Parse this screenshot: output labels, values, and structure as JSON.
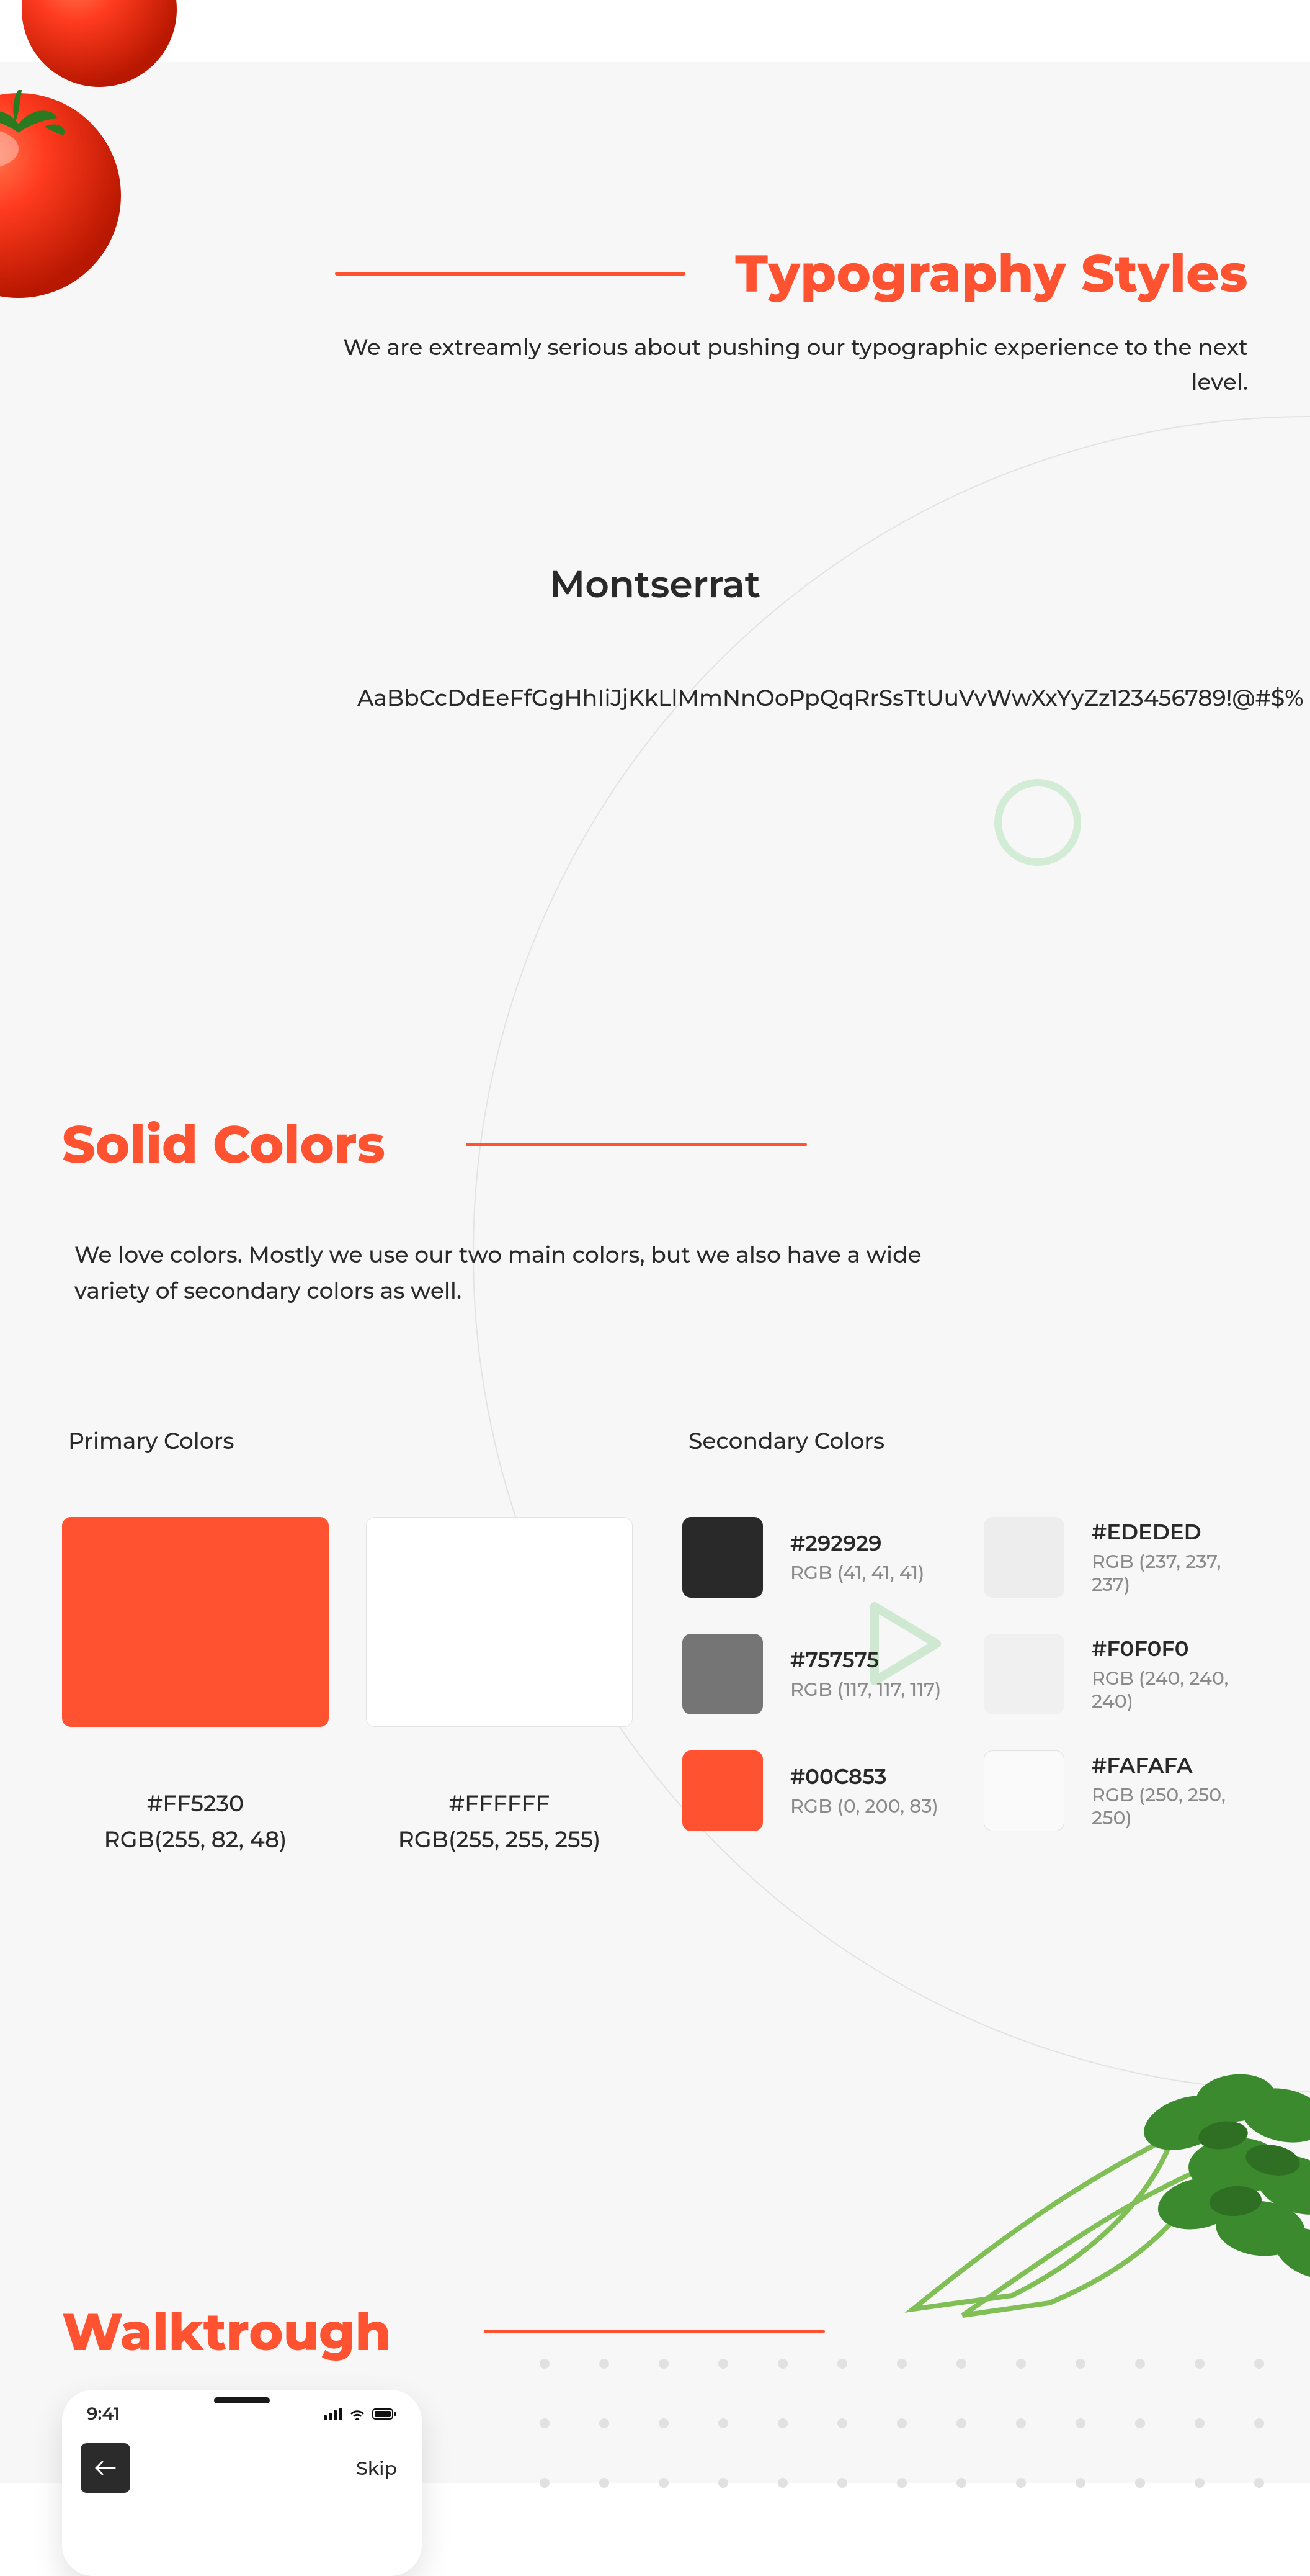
{
  "typography": {
    "title": "Typography Styles",
    "subtitle": "We are extreamly serious about pushing our typographic experience to the next level.",
    "font_name": "Montserrat",
    "glyphs": "AaBbCcDdEeFfGgHhIiJjKkLlMmNnOoPpQqRrSsTtUuVvWwXxYyZz123456789!@#$%"
  },
  "colors": {
    "title": "Solid Colors",
    "subtitle": "We love colors. Mostly we use our two main colors, but we also have a wide variety of secondary colors as well.",
    "primary_label": "Primary Colors",
    "secondary_label": "Secondary Colors",
    "primary": [
      {
        "hex": "#FF5230",
        "rgb": "RGB(255, 82, 48)",
        "fill": "#ff5230",
        "outline": false
      },
      {
        "hex": "#FFFFFF",
        "rgb": "RGB(255, 255, 255)",
        "fill": "#ffffff",
        "outline": true
      }
    ],
    "secondary_left": [
      {
        "hex": "#292929",
        "rgb": "RGB (41, 41, 41)",
        "fill": "#292929",
        "outline": false
      },
      {
        "hex": "#757575",
        "rgb": "RGB (117, 117, 117)",
        "fill": "#757575",
        "outline": false
      },
      {
        "hex": "#00C853",
        "rgb": "RGB (0, 200, 83)",
        "fill": "#ff5230",
        "outline": false
      }
    ],
    "secondary_right": [
      {
        "hex": "#EDEDED",
        "rgb": "RGB (237, 237, 237)",
        "fill": "#ededed",
        "outline": false
      },
      {
        "hex": "#F0F0F0",
        "rgb": "RGB (240, 240, 240)",
        "fill": "#f0f0f0",
        "outline": false
      },
      {
        "hex": "#FAFAFA",
        "rgb": "RGB (250, 250, 250)",
        "fill": "#fafafa",
        "outline": true
      }
    ]
  },
  "walkthrough": {
    "title": "Walktrough"
  },
  "phone": {
    "time": "9:41",
    "skip": "Skip"
  }
}
